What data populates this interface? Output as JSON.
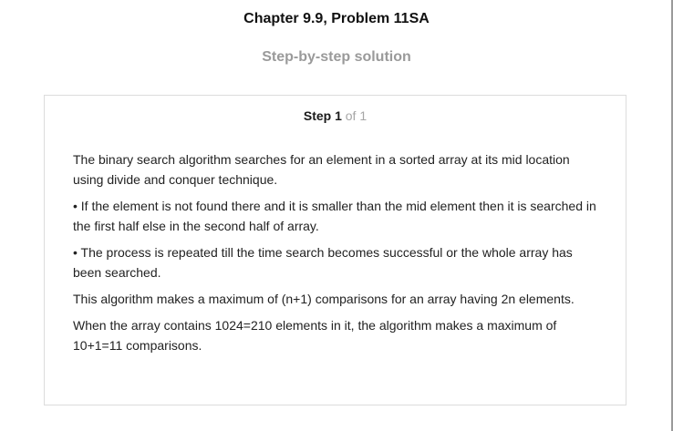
{
  "header": {
    "chapter_title": "Chapter 9.9, Problem 11SA",
    "subtitle": "Step-by-step solution"
  },
  "step": {
    "label": "Step 1",
    "of": "of 1"
  },
  "paragraphs": [
    "The binary search algorithm searches for an element in a sorted array at its mid location using divide and conquer technique.",
    "• If the element is not found there and it is smaller than the mid element then it is searched in the first half else in the second half of array.",
    "• The process is repeated till the time search becomes successful or the whole array has been searched.",
    "This algorithm makes a maximum of (n+1) comparisons for an array having 2n elements.",
    "When the array contains 1024=210 elements in it, the algorithm makes a maximum of 10+1=11 comparisons."
  ]
}
